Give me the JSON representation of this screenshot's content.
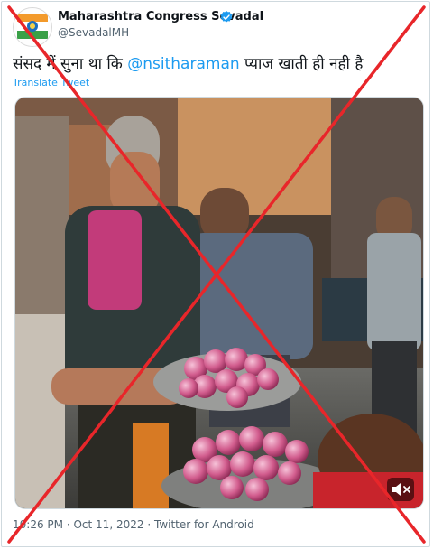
{
  "tweet": {
    "display_name": "Maharashtra Congress Sevadal",
    "handle": "@SevadalMH",
    "verified": true,
    "text_before": "संसद में सुना था कि ",
    "mention": "@nsitharaman",
    "text_after": " प्याज खाती ही नही है",
    "translate_label": "Translate Tweet",
    "time": "10:26 PM",
    "date": "Oct 11, 2022",
    "source": "Twitter for Android",
    "separator": "·"
  },
  "media": {
    "type": "video",
    "mute_icon": "speaker-muted-icon"
  },
  "overlay": {
    "mark": "red-cross",
    "color": "#e8262a"
  },
  "colors": {
    "link": "#1d9bf0",
    "secondary_text": "#536471",
    "verified_badge": "#1d9bf0"
  }
}
